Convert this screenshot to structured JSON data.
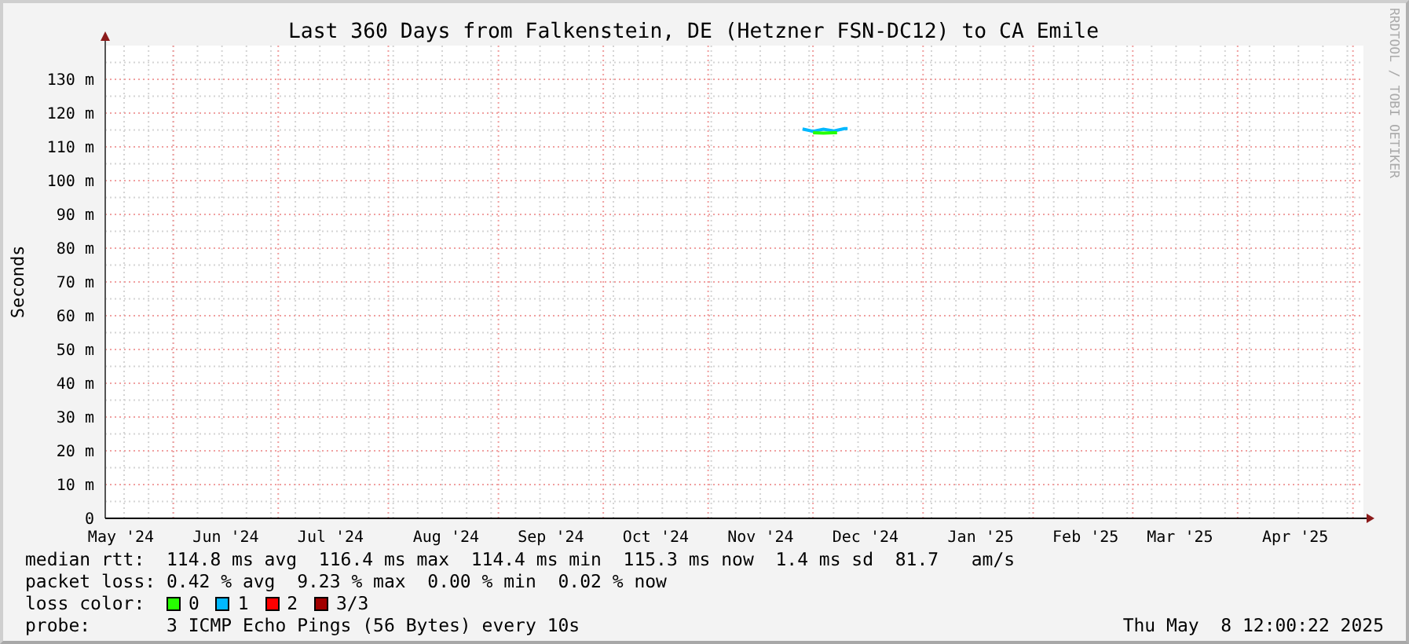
{
  "title": "Last 360 Days from Falkenstein, DE (Hetzner FSN-DC12) to CA Emile",
  "credit": "RRDTOOL / TOBI OETIKER",
  "chart": {
    "chart_data": {
      "type": "line",
      "grid": true,
      "ylabel": "Seconds",
      "ylim": [
        0,
        140
      ],
      "categories": [
        null,
        "May '24",
        null,
        null,
        null,
        null,
        null,
        null,
        null,
        null,
        null,
        "Jun '24",
        null,
        null,
        null,
        null,
        null,
        null,
        null,
        null,
        null,
        "Jul '24",
        null,
        null,
        null,
        null,
        null,
        null,
        null,
        null,
        null,
        null,
        "Aug '24",
        null,
        null,
        null,
        null,
        null,
        null,
        null,
        null,
        null,
        "Sep '24",
        null,
        null,
        null,
        null,
        null,
        null,
        null,
        null,
        null,
        "Oct '24",
        null,
        null,
        null,
        null,
        null,
        null,
        null,
        null,
        null,
        "Nov '24",
        null,
        null,
        null,
        null,
        null,
        null,
        null,
        null,
        null,
        "Dec '24",
        null,
        null,
        null,
        null,
        null,
        null,
        null,
        null,
        null,
        null,
        "Jan '25",
        null,
        null,
        null,
        null,
        null,
        null,
        null,
        null,
        null,
        "Feb '25",
        null,
        null,
        null,
        null,
        null,
        null,
        null,
        null,
        "Mar '25",
        null,
        null,
        null,
        null,
        null,
        null,
        null,
        null,
        null,
        null,
        "Apr '25",
        null,
        null,
        null,
        null,
        null,
        null
      ],
      "yticks": [
        {
          "value": 0,
          "label": "0"
        },
        {
          "value": 10,
          "label": "10 m"
        },
        {
          "value": 20,
          "label": "20 m"
        },
        {
          "value": 30,
          "label": "30 m"
        },
        {
          "value": 40,
          "label": "40 m"
        },
        {
          "value": 50,
          "label": "50 m"
        },
        {
          "value": 60,
          "label": "60 m"
        },
        {
          "value": 70,
          "label": "70 m"
        },
        {
          "value": 80,
          "label": "80 m"
        },
        {
          "value": 90,
          "label": "90 m"
        },
        {
          "value": 100,
          "label": "100 m"
        },
        {
          "value": 110,
          "label": "110 m"
        },
        {
          "value": 120,
          "label": "120 m"
        },
        {
          "value": 130,
          "label": "130 m"
        }
      ],
      "series": [
        {
          "color": "#00b8ff",
          "values": [
            null,
            null,
            null,
            null,
            null,
            null,
            null,
            null,
            null,
            null,
            null,
            null,
            null,
            null,
            null,
            null,
            null,
            null,
            null,
            null,
            null,
            null,
            null,
            null,
            null,
            null,
            null,
            null,
            null,
            null,
            null,
            null,
            null,
            null,
            null,
            null,
            null,
            null,
            null,
            null,
            null,
            null,
            null,
            null,
            null,
            null,
            null,
            null,
            null,
            null,
            null,
            null,
            null,
            null,
            null,
            null,
            null,
            null,
            null,
            null,
            null,
            null,
            null,
            null,
            null,
            null,
            115.3,
            114.6,
            115.2,
            114.7,
            115.4,
            null,
            null,
            null,
            null,
            null,
            null,
            null,
            null,
            null,
            null,
            null,
            null,
            null,
            null,
            null,
            null,
            null,
            null,
            null,
            null,
            null,
            null,
            null,
            null,
            null,
            null,
            null,
            null,
            null,
            null,
            null,
            null,
            null,
            null,
            null,
            null,
            null,
            null,
            null,
            null,
            null,
            null,
            null,
            null,
            null,
            null,
            null,
            null,
            null
          ]
        },
        {
          "color": "#26ff00",
          "values": [
            null,
            null,
            null,
            null,
            null,
            null,
            null,
            null,
            null,
            null,
            null,
            null,
            null,
            null,
            null,
            null,
            null,
            null,
            null,
            null,
            null,
            null,
            null,
            null,
            null,
            null,
            null,
            null,
            null,
            null,
            null,
            null,
            null,
            null,
            null,
            null,
            null,
            null,
            null,
            null,
            null,
            null,
            null,
            null,
            null,
            null,
            null,
            null,
            null,
            null,
            null,
            null,
            null,
            null,
            null,
            null,
            null,
            null,
            null,
            null,
            null,
            null,
            null,
            null,
            null,
            null,
            null,
            114.2,
            114.1,
            114.2,
            null,
            null,
            null,
            null,
            null,
            null,
            null,
            null,
            null,
            null,
            null,
            null,
            null,
            null,
            null,
            null,
            null,
            null,
            null,
            null,
            null,
            null,
            null,
            null,
            null,
            null,
            null,
            null,
            null,
            null,
            null,
            null,
            null,
            null,
            null,
            null,
            null,
            null,
            null,
            null,
            null,
            null,
            null,
            null,
            null,
            null,
            null,
            null,
            null,
            null
          ]
        }
      ]
    }
  },
  "legend": {
    "median_rtt": {
      "label": "median rtt:",
      "text": "114.8 ms avg  116.4 ms max  114.4 ms min  115.3 ms now  1.4 ms sd  81.7   am/s"
    },
    "packet_loss": {
      "label": "packet loss:",
      "text": "0.42 % avg  9.23 % max  0.00 % min  0.02 % now"
    },
    "loss_color": {
      "label": "loss color:",
      "items": [
        {
          "label": "0",
          "color": "#26ff00"
        },
        {
          "label": "1",
          "color": "#00b8ff"
        },
        {
          "label": "2",
          "color": "#ff0000"
        },
        {
          "label": "3/3",
          "color": "#a10000"
        }
      ]
    },
    "probe": {
      "label": "probe:",
      "text": "3 ICMP Echo Pings (56 Bytes) every 10s"
    },
    "timestamp": "Thu May  8 12:00:22 2025"
  }
}
